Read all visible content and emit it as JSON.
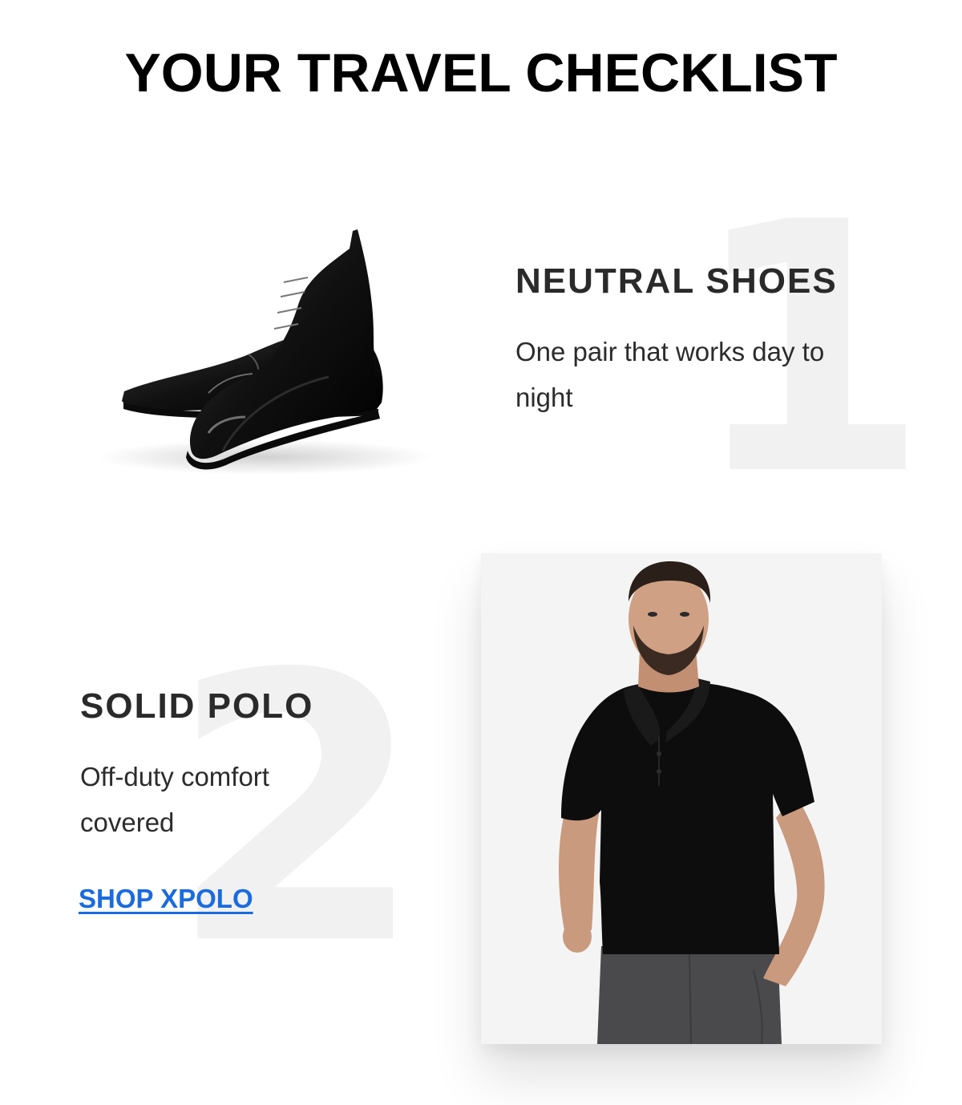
{
  "page": {
    "title": "YOUR TRAVEL CHECKLIST"
  },
  "items": [
    {
      "number": "1",
      "heading": "NEUTRAL SHOES",
      "description": "One pair that works day to night",
      "image_subject": "black cap-toe oxford shoes"
    },
    {
      "number": "2",
      "heading": "SOLID POLO",
      "description": "Off-duty comfort covered",
      "image_subject": "man wearing black polo shirt and grey trousers",
      "cta": "SHOP XPOLO"
    }
  ],
  "colors": {
    "title": "#000000",
    "heading": "#2a2a2a",
    "body_text": "#2c2c2c",
    "watermark_number": "#f1f1f1",
    "link": "#1a6be0",
    "image_card_background": "#f4f4f4"
  }
}
